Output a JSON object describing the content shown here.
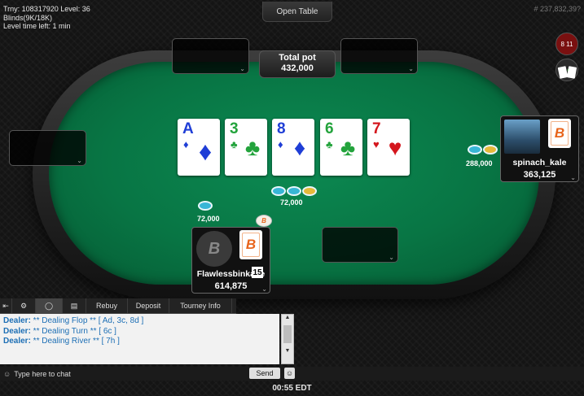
{
  "tourney": {
    "line1": "Trny: 108317920 Level: 36",
    "line2": "Blinds(9K/18K)",
    "line3": "Level time left: 1 min"
  },
  "header": {
    "open_table": "Open Table",
    "hand_id": "# 237,832,39?"
  },
  "tools": {
    "badge1": "8 11"
  },
  "pot": {
    "label": "Total pot",
    "amount": "432,000"
  },
  "board": [
    {
      "rank": "A",
      "suit": "♦",
      "color": "#1f3ed6"
    },
    {
      "rank": "3",
      "suit": "♣",
      "color": "#23a33c"
    },
    {
      "rank": "8",
      "suit": "♦",
      "color": "#1f3ed6"
    },
    {
      "rank": "6",
      "suit": "♣",
      "color": "#23a33c"
    },
    {
      "rank": "7",
      "suit": "♥",
      "color": "#d4161d"
    }
  ],
  "bets": {
    "center": "72,000",
    "hero": "72,000",
    "villain": "288,000"
  },
  "hero": {
    "name": "Flawlessbinkage",
    "stack": "614,875",
    "timer": "15",
    "avatar_letter": "B"
  },
  "villain": {
    "name": "spinach_kale",
    "stack": "363,125"
  },
  "brand_letter": "B",
  "tabs": {
    "rebuy": "Rebuy",
    "deposit": "Deposit",
    "tourney_info": "Tourney Info"
  },
  "chat": {
    "lines": [
      {
        "who": "Dealer:",
        "text": " ** Dealing Flop ** [ Ad, 3c, 8d ]"
      },
      {
        "who": "Dealer:",
        "text": " ** Dealing Turn ** [ 6c ]"
      },
      {
        "who": "Dealer:",
        "text": " ** Dealing River ** [ 7h ]"
      }
    ],
    "placeholder": "Type here to chat",
    "send": "Send"
  },
  "clock": "00:55 EDT"
}
